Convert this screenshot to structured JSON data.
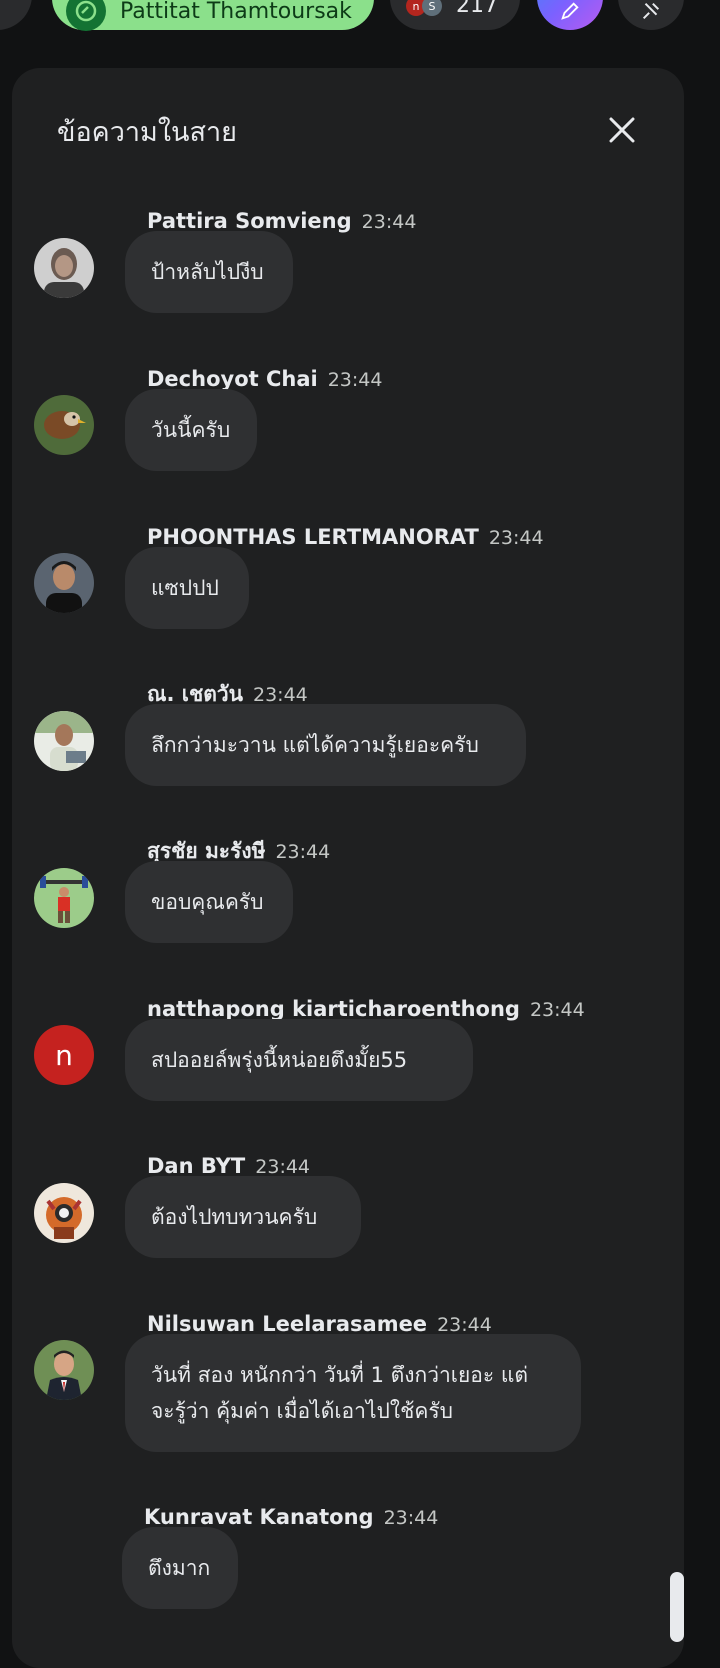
{
  "topbar": {
    "presenter_label": "Pattitat Thamtoursak",
    "people_count": "217",
    "mini_avatars": [
      {
        "letter": "n",
        "color": "#b3261e"
      },
      {
        "letter": "S",
        "color": "#5f6f7a"
      }
    ]
  },
  "panel": {
    "title": "ข้อความในสาย"
  },
  "messages": [
    {
      "name": "Pattira Somvieng",
      "time": "23:44",
      "text": "ป้าหลับไปงีบ",
      "avatar": "photo-woman"
    },
    {
      "name": "Dechoyot Chai",
      "time": "23:44",
      "text": "วันนี้ครับ",
      "avatar": "photo-eagle"
    },
    {
      "name": "PHOONTHAS LERTMANORAT",
      "time": "23:44",
      "text": "แซปปป",
      "avatar": "photo-man"
    },
    {
      "name": "ณ. เชตวัน",
      "time": "23:44",
      "text": "ลึกกว่ามะวาน แต่ได้ความรู้เยอะครับ",
      "avatar": "photo-outdoor"
    },
    {
      "name": "สุรชัย มะรังษี",
      "time": "23:44",
      "text": "ขอบคุณครับ",
      "avatar": "illustration-lifter"
    },
    {
      "name": "natthapong kiarticharoenthong",
      "time": "23:44",
      "text": "สปออยล์พรุ่งนี้หน่อยตึงมั้ย55",
      "avatar_letter": "n",
      "avatar_color": "#c5221f"
    },
    {
      "name": "Dan BYT",
      "time": "23:44",
      "text": "ต้องไปทบทวนครับ",
      "avatar": "illustration-creature"
    },
    {
      "name": "Nilsuwan Leelarasamee",
      "time": "23:44",
      "text_line1": "วันที่ สอง หนักกว่า วันที่ 1 ตึงกว่าเยอะ แต่",
      "text_line2": "จะรู้ว่า คุ้มค่า เมื่อได้เอาไปใช้ครับ",
      "avatar": "photo-suit"
    },
    {
      "name": "Kunravat Kanatong",
      "time": "23:44",
      "text": "ตึงมาก"
    }
  ]
}
